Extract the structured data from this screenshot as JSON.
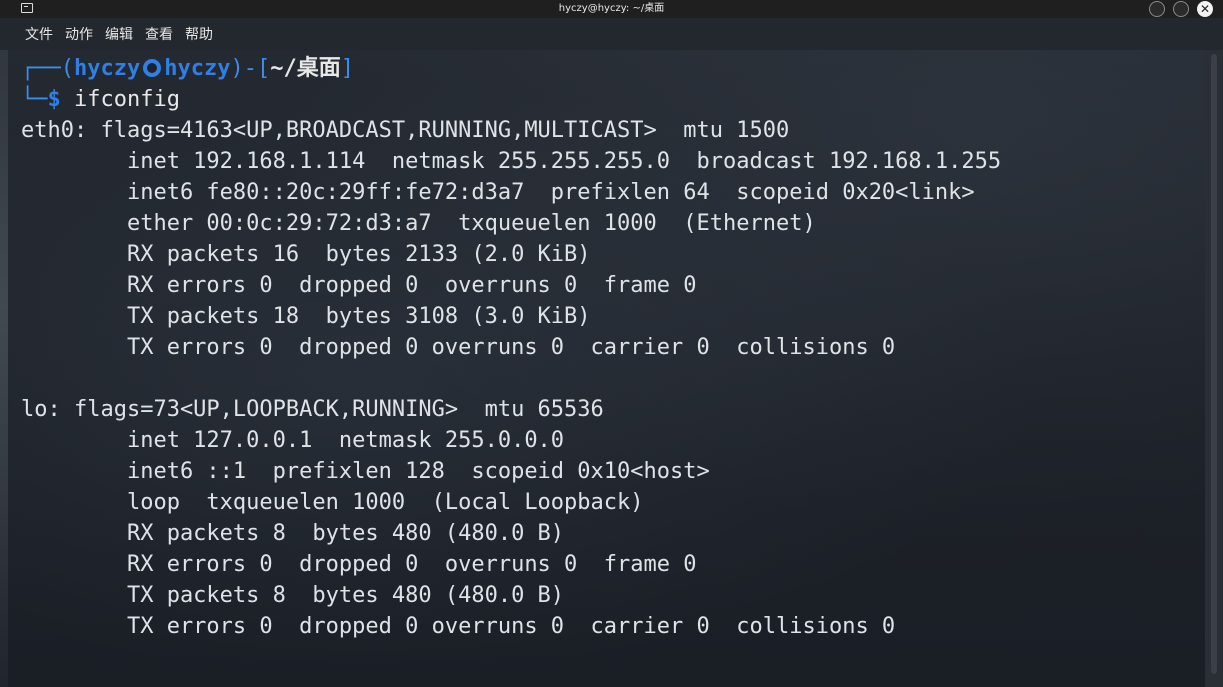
{
  "window": {
    "title": "hyczy@hyczy: ~/桌面"
  },
  "menu": {
    "items": [
      "文件",
      "动作",
      "编辑",
      "查看",
      "帮助"
    ]
  },
  "prompt": {
    "frame_open": "┌──(",
    "user": "hyczy",
    "host": "hyczy",
    "frame_mid": ")-[",
    "path": "~/桌面",
    "frame_close": "]",
    "frame_bottom": "└─",
    "dollar": "$",
    "command": "ifconfig"
  },
  "output": [
    "eth0: flags=4163<UP,BROADCAST,RUNNING,MULTICAST>  mtu 1500",
    "        inet 192.168.1.114  netmask 255.255.255.0  broadcast 192.168.1.255",
    "        inet6 fe80::20c:29ff:fe72:d3a7  prefixlen 64  scopeid 0x20<link>",
    "        ether 00:0c:29:72:d3:a7  txqueuelen 1000  (Ethernet)",
    "        RX packets 16  bytes 2133 (2.0 KiB)",
    "        RX errors 0  dropped 0  overruns 0  frame 0",
    "        TX packets 18  bytes 3108 (3.0 KiB)",
    "        TX errors 0  dropped 0 overruns 0  carrier 0  collisions 0",
    "",
    "lo: flags=73<UP,LOOPBACK,RUNNING>  mtu 65536",
    "        inet 127.0.0.1  netmask 255.0.0.0",
    "        inet6 ::1  prefixlen 128  scopeid 0x10<host>",
    "        loop  txqueuelen 1000  (Local Loopback)",
    "        RX packets 8  bytes 480 (480.0 B)",
    "        RX errors 0  dropped 0  overruns 0  frame 0",
    "        TX packets 8  bytes 480 (480.0 B)",
    "        TX errors 0  dropped 0 overruns 0  carrier 0  collisions 0"
  ],
  "window_buttons": {
    "close_glyph": "✕"
  }
}
